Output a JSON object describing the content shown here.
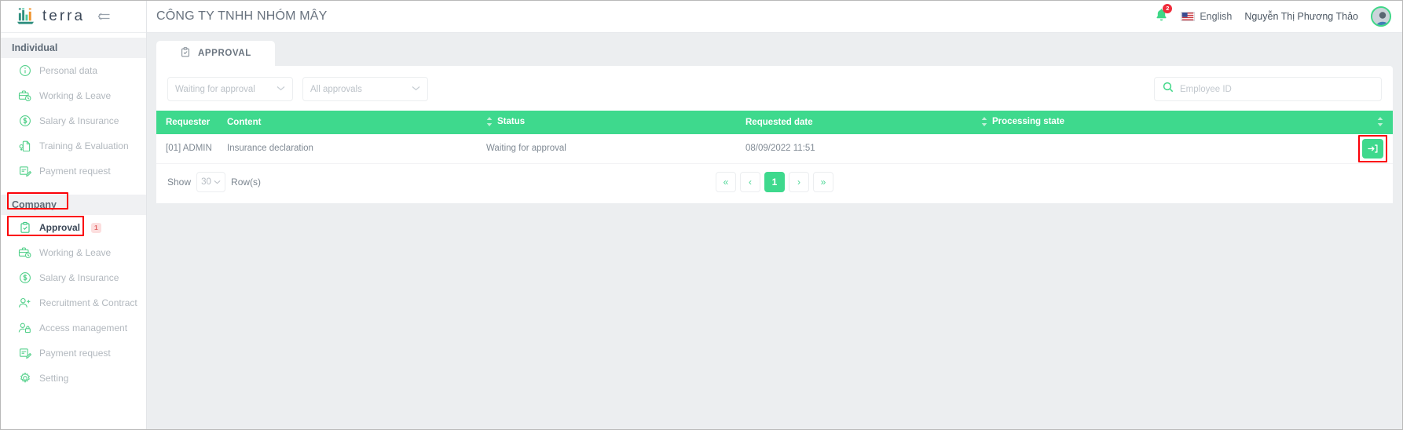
{
  "brand": {
    "name": "terra",
    "logo_icon": "bar-chart-logo",
    "collapse_icon": "collapse-sidebar-icon"
  },
  "sidebar": {
    "sections": [
      {
        "label": "Individual",
        "items": [
          {
            "label": "Personal data",
            "icon": "info-circle-icon",
            "active": false,
            "badge": ""
          },
          {
            "label": "Working & Leave",
            "icon": "briefcase-clock-icon",
            "active": false,
            "badge": ""
          },
          {
            "label": "Salary & Insurance",
            "icon": "dollar-circle-icon",
            "active": false,
            "badge": ""
          },
          {
            "label": "Training & Evaluation",
            "icon": "document-training-icon",
            "active": false,
            "badge": ""
          },
          {
            "label": "Payment request",
            "icon": "invoice-edit-icon",
            "active": false,
            "badge": ""
          }
        ]
      },
      {
        "label": "Company",
        "items": [
          {
            "label": "Approval",
            "icon": "clipboard-check-icon",
            "active": true,
            "badge": "1"
          },
          {
            "label": "Working & Leave",
            "icon": "briefcase-clock-icon",
            "active": false,
            "badge": ""
          },
          {
            "label": "Salary & Insurance",
            "icon": "dollar-circle-icon",
            "active": false,
            "badge": ""
          },
          {
            "label": "Recruitment & Contract",
            "icon": "user-plus-icon",
            "active": false,
            "badge": ""
          },
          {
            "label": "Access management",
            "icon": "user-lock-icon",
            "active": false,
            "badge": ""
          },
          {
            "label": "Payment request",
            "icon": "invoice-edit-icon",
            "active": false,
            "badge": ""
          },
          {
            "label": "Setting",
            "icon": "gear-icon",
            "active": false,
            "badge": ""
          }
        ]
      }
    ]
  },
  "header": {
    "title": "CÔNG TY TNHH NHÓM MÂY",
    "notification_icon": "bell-icon",
    "notification_count": "2",
    "language_icon": "us-flag-icon",
    "language": "English",
    "user_name": "Nguyễn Thị Phương Thảo",
    "avatar_icon": "user-avatar"
  },
  "tabs": [
    {
      "label": "APPROVAL",
      "icon": "clipboard-check-icon",
      "active": true
    }
  ],
  "filters": {
    "status_select": {
      "value": "Waiting for approval",
      "caret_icon": "chevron-down-icon"
    },
    "type_select": {
      "value": "All approvals",
      "caret_icon": "chevron-down-icon"
    },
    "search": {
      "placeholder": "Employee ID",
      "value": "",
      "icon": "search-icon"
    }
  },
  "table": {
    "columns": [
      {
        "label": "Requester",
        "sortable": false
      },
      {
        "label": "Content",
        "sortable": true
      },
      {
        "label": "Status",
        "sortable": false
      },
      {
        "label": "Requested date",
        "sortable": true
      },
      {
        "label": "Processing state",
        "sortable": true
      },
      {
        "label": "",
        "sortable": false
      }
    ],
    "rows": [
      {
        "requester": "[01] ADMIN",
        "content": "Insurance declaration",
        "status": "Waiting for approval",
        "requested_date": "08/09/2022 11:51",
        "processing_state": "",
        "action_icon": "arrow-into-box-icon"
      }
    ]
  },
  "footer": {
    "show_label": "Show",
    "rows_value": "30",
    "rows_caret_icon": "chevron-down-icon",
    "rows_label": "Row(s)",
    "pagination": {
      "first": "«",
      "prev": "‹",
      "current": "1",
      "next": "›",
      "last": "»"
    }
  },
  "colors": {
    "accent_green": "#3ed98d",
    "badge_red": "#ef2b3a",
    "highlight_red": "#fb0007",
    "text_muted": "#b2b8be"
  }
}
